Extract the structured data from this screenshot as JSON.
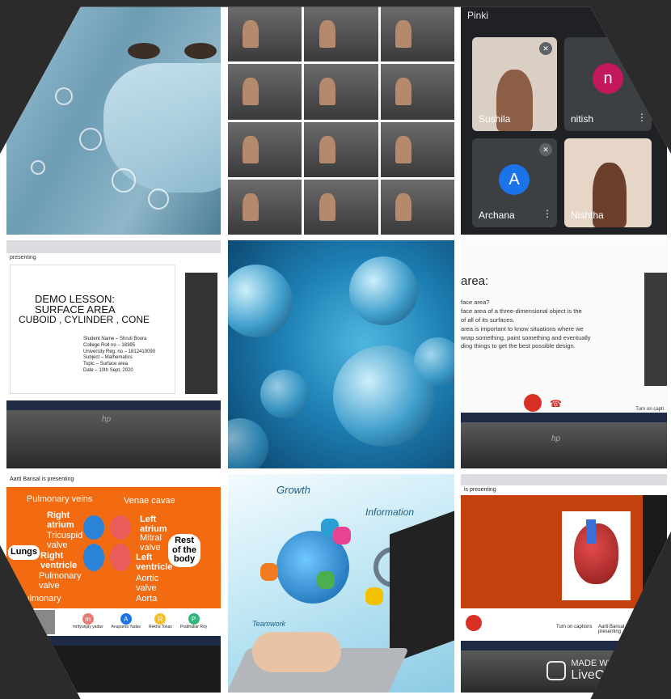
{
  "tile_meet": {
    "top_label": "Pinki",
    "participants": [
      {
        "name": "Sushila",
        "type": "video"
      },
      {
        "name": "nitish",
        "type": "avatar",
        "letter": "n",
        "color": "#c2185b"
      },
      {
        "name": "Archana",
        "type": "avatar",
        "letter": "A",
        "color": "#1a73e8"
      },
      {
        "name": "Nishtha",
        "type": "video"
      }
    ]
  },
  "tile_surface": {
    "presenting": "presenting",
    "title_line1": "DEMO LESSON:",
    "title_line2": "SURFACE AREA",
    "title_line3": "CUBOID , CYLINDER , CONE",
    "details": [
      "Student Name – Shruti Boora",
      "College Roll no – 18395",
      "University Reg. no – 1812410090",
      "Subject – Mathematics",
      "Topic – Surface area",
      "Date – 10th Sept, 2020"
    ],
    "laptop_brand": "hp"
  },
  "tile_area": {
    "title": "area:",
    "lines": [
      "face area?",
      "face area of a three-dimensional object is the",
      "of all of its surfaces.",
      "area is important to know situations where we",
      "wrap something, paint something and eventually",
      "ding things to get the best possible design."
    ],
    "turn_on_captions": "Turn on capti",
    "laptop_brand": "hp"
  },
  "tile_heart": {
    "presenting": "Aarti Bansal is presenting",
    "labels": {
      "pulmonary_veins": "Pulmonary veins",
      "venae_cavae": "Venae cavae",
      "right_atrium": "Right atrium",
      "tricuspid_valve": "Tricuspid valve",
      "left_atrium": "Left atrium",
      "mitral_valve": "Mitral valve",
      "lungs": "Lungs",
      "rest_of_body": "Rest of the body",
      "right_ventricle": "Right ventricle",
      "left_ventricle": "Left ventricle",
      "pulmonary_valve": "Pulmonary valve",
      "aortic_valve": "Aortic valve",
      "pulmonary": "Pulmonary",
      "aorta": "Aorta"
    },
    "attendees": [
      {
        "letter": "m",
        "name": "mrityunjay yadav",
        "color": "#e67c73"
      },
      {
        "letter": "A",
        "name": "Anupama Yadav",
        "color": "#1a73e8"
      },
      {
        "letter": "R",
        "name": "Rekha Tokas",
        "color": "#f6bf26"
      },
      {
        "letter": "P",
        "name": "Prabhakar Roy",
        "color": "#33b679"
      }
    ]
  },
  "tile_heart2": {
    "presenting": "is presenting",
    "turn_on_captions": "Turn on captions",
    "presenting_label": "Aarti Bansal is presenting"
  },
  "tile_tech": {
    "word1": "Growth",
    "word2": "Information",
    "word3": "Teamwork"
  },
  "watermark": {
    "line1": "MADE WITH",
    "line2": "LiveCollage"
  },
  "colors": {
    "meet_bg": "#202124",
    "heart_slide": "#f36b10",
    "virus_blue": "#1d7fb4"
  }
}
